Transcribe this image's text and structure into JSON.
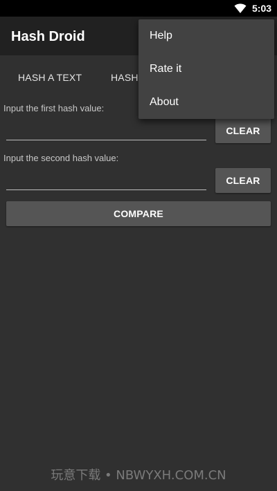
{
  "status_bar": {
    "time": "5:03",
    "wifi_icon": "wifi-icon"
  },
  "app_bar": {
    "title": "Hash Droid"
  },
  "tabs": [
    {
      "label": "HASH A TEXT"
    },
    {
      "label": "HASH"
    }
  ],
  "form": {
    "first_label": "Input the first hash value:",
    "first_value": "",
    "second_label": "Input the second hash value:",
    "second_value": "",
    "clear_label": "CLEAR",
    "compare_label": "COMPARE"
  },
  "overflow_menu": {
    "items": [
      {
        "label": "Help"
      },
      {
        "label": "Rate it"
      },
      {
        "label": "About"
      }
    ]
  },
  "watermark": "玩意下载 • NBWYXH.COM.CN",
  "colors": {
    "background": "#303030",
    "app_bar": "#212121",
    "menu": "#424242",
    "button": "#555555"
  }
}
